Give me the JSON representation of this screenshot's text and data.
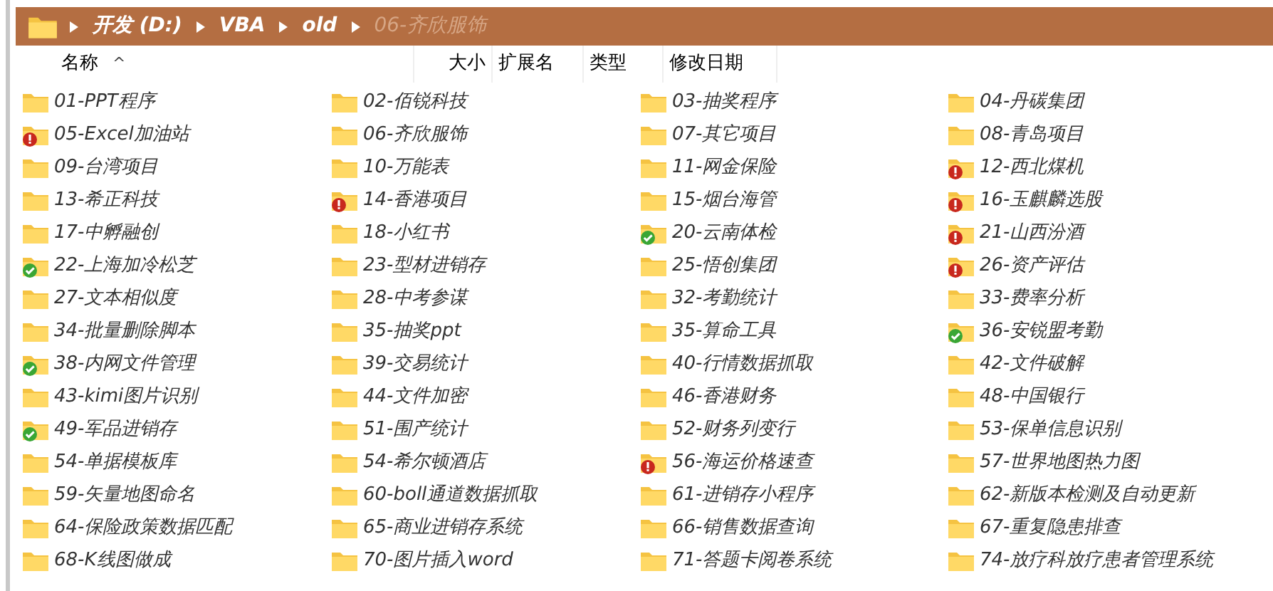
{
  "breadcrumb": [
    {
      "label": "开发 (D:)",
      "current": false
    },
    {
      "label": "VBA",
      "current": false
    },
    {
      "label": "old",
      "current": false
    },
    {
      "label": "06-齐欣服饰",
      "current": true
    }
  ],
  "columns": [
    {
      "label": "名称",
      "sorted": true
    },
    {
      "label": "大小",
      "sorted": false
    },
    {
      "label": "扩展名",
      "sorted": false
    },
    {
      "label": "类型",
      "sorted": false
    },
    {
      "label": "修改日期",
      "sorted": false
    }
  ],
  "sort_indicator": "^",
  "folders": [
    {
      "name": "01-PPT程序",
      "error": false,
      "synced": false
    },
    {
      "name": "02-佰锐科技",
      "error": false,
      "synced": false
    },
    {
      "name": "03-抽奖程序",
      "error": false,
      "synced": false
    },
    {
      "name": "04-丹碳集团",
      "error": false,
      "synced": false
    },
    {
      "name": "05-Excel加油站",
      "error": true,
      "synced": false
    },
    {
      "name": "06-齐欣服饰",
      "error": false,
      "synced": false
    },
    {
      "name": "07-其它项目",
      "error": false,
      "synced": false
    },
    {
      "name": "08-青岛项目",
      "error": false,
      "synced": false
    },
    {
      "name": "09-台湾项目",
      "error": false,
      "synced": false
    },
    {
      "name": "10-万能表",
      "error": false,
      "synced": false
    },
    {
      "name": "11-网金保险",
      "error": false,
      "synced": false
    },
    {
      "name": "12-西北煤机",
      "error": true,
      "synced": false
    },
    {
      "name": "13-希正科技",
      "error": false,
      "synced": false
    },
    {
      "name": "14-香港项目",
      "error": true,
      "synced": false
    },
    {
      "name": "15-烟台海管",
      "error": false,
      "synced": false
    },
    {
      "name": "16-玉麒麟选股",
      "error": true,
      "synced": false
    },
    {
      "name": "17-中孵融创",
      "error": false,
      "synced": false
    },
    {
      "name": "18-小红书",
      "error": false,
      "synced": false
    },
    {
      "name": "20-云南体检",
      "error": false,
      "synced": true
    },
    {
      "name": "21-山西汾酒",
      "error": true,
      "synced": false
    },
    {
      "name": "22-上海加冷松芝",
      "error": false,
      "synced": true
    },
    {
      "name": "23-型材进销存",
      "error": false,
      "synced": false
    },
    {
      "name": "25-悟创集团",
      "error": false,
      "synced": false
    },
    {
      "name": "26-资产评估",
      "error": true,
      "synced": false
    },
    {
      "name": "27-文本相似度",
      "error": false,
      "synced": false
    },
    {
      "name": "28-中考参谋",
      "error": false,
      "synced": false
    },
    {
      "name": "32-考勤统计",
      "error": false,
      "synced": false
    },
    {
      "name": "33-费率分析",
      "error": false,
      "synced": false
    },
    {
      "name": "34-批量删除脚本",
      "error": false,
      "synced": false
    },
    {
      "name": "35-抽奖ppt",
      "error": false,
      "synced": false
    },
    {
      "name": "35-算命工具",
      "error": false,
      "synced": false
    },
    {
      "name": "36-安锐盟考勤",
      "error": false,
      "synced": true
    },
    {
      "name": "38-内网文件管理",
      "error": false,
      "synced": true
    },
    {
      "name": "39-交易统计",
      "error": false,
      "synced": false
    },
    {
      "name": "40-行情数据抓取",
      "error": false,
      "synced": false
    },
    {
      "name": "42-文件破解",
      "error": false,
      "synced": false
    },
    {
      "name": "43-kimi图片识别",
      "error": false,
      "synced": false
    },
    {
      "name": "44-文件加密",
      "error": false,
      "synced": false
    },
    {
      "name": "46-香港财务",
      "error": false,
      "synced": false
    },
    {
      "name": "48-中国银行",
      "error": false,
      "synced": false
    },
    {
      "name": "49-军品进销存",
      "error": false,
      "synced": true
    },
    {
      "name": "51-围产统计",
      "error": false,
      "synced": false
    },
    {
      "name": "52-财务列变行",
      "error": false,
      "synced": false
    },
    {
      "name": "53-保单信息识别",
      "error": false,
      "synced": false
    },
    {
      "name": "54-单据模板库",
      "error": false,
      "synced": false
    },
    {
      "name": "54-希尔顿酒店",
      "error": false,
      "synced": false
    },
    {
      "name": "56-海运价格速查",
      "error": true,
      "synced": false
    },
    {
      "name": "57-世界地图热力图",
      "error": false,
      "synced": false
    },
    {
      "name": "59-矢量地图命名",
      "error": false,
      "synced": false
    },
    {
      "name": "60-boll通道数据抓取",
      "error": false,
      "synced": false
    },
    {
      "name": "61-进销存小程序",
      "error": false,
      "synced": false
    },
    {
      "name": "62-新版本检测及自动更新",
      "error": false,
      "synced": false
    },
    {
      "name": "64-保险政策数据匹配",
      "error": false,
      "synced": false
    },
    {
      "name": "65-商业进销存系统",
      "error": false,
      "synced": false
    },
    {
      "name": "66-销售数据查询",
      "error": false,
      "synced": false
    },
    {
      "name": "67-重复隐患排查",
      "error": false,
      "synced": false
    },
    {
      "name": "68-K线图做成",
      "error": false,
      "synced": false
    },
    {
      "name": "70-图片插入word",
      "error": false,
      "synced": false
    },
    {
      "name": "71-答题卡阅卷系统",
      "error": false,
      "synced": false
    },
    {
      "name": "74-放疗科放疗患者管理系统",
      "error": false,
      "synced": false
    }
  ]
}
